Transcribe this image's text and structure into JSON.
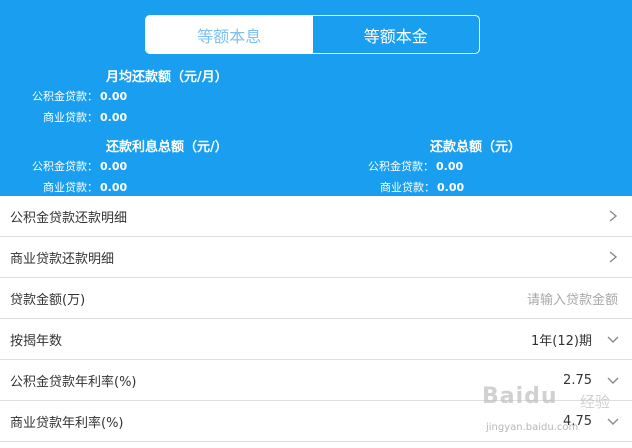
{
  "tabs": [
    {
      "label": "等额本息",
      "active": true
    },
    {
      "label": "等额本金",
      "active": false
    }
  ],
  "monthly": {
    "title": "月均还款额（元/月）",
    "fund_label": "公积金贷款：",
    "fund_value": "0.00",
    "commercial_label": "商业贷款：",
    "commercial_value": "0.00"
  },
  "interest_total": {
    "title": "还款利息总额（元/）",
    "fund_label": "公积金贷款：",
    "fund_value": "0.00",
    "commercial_label": "商业贷款：",
    "commercial_value": "0.00"
  },
  "repay_total": {
    "title": "还款总额（元）",
    "fund_label": "公积金贷款：",
    "fund_value": "0.00",
    "commercial_label": "商业贷款：",
    "commercial_value": "0.00"
  },
  "rows": {
    "fund_detail": "公积金贷款还款明细",
    "commercial_detail": "商业贷款还款明细",
    "loan_amount_label": "贷款金额(万)",
    "loan_amount_placeholder": "请输入贷款金额",
    "years_label": "按揭年数",
    "years_value": "1年(12)期",
    "fund_rate_label": "公积金贷款年利率(%)",
    "fund_rate_value": "2.75",
    "commercial_rate_label": "商业贷款年利率(%)",
    "commercial_rate_value": "4.75"
  },
  "watermark": {
    "brand": "Baidu",
    "sub": "经验",
    "url": "jingyan.baidu.com"
  },
  "colors": {
    "hero_bg": "#1a9ff0",
    "active_tab_text": "#7fc1ee",
    "divider": "#dedede"
  }
}
